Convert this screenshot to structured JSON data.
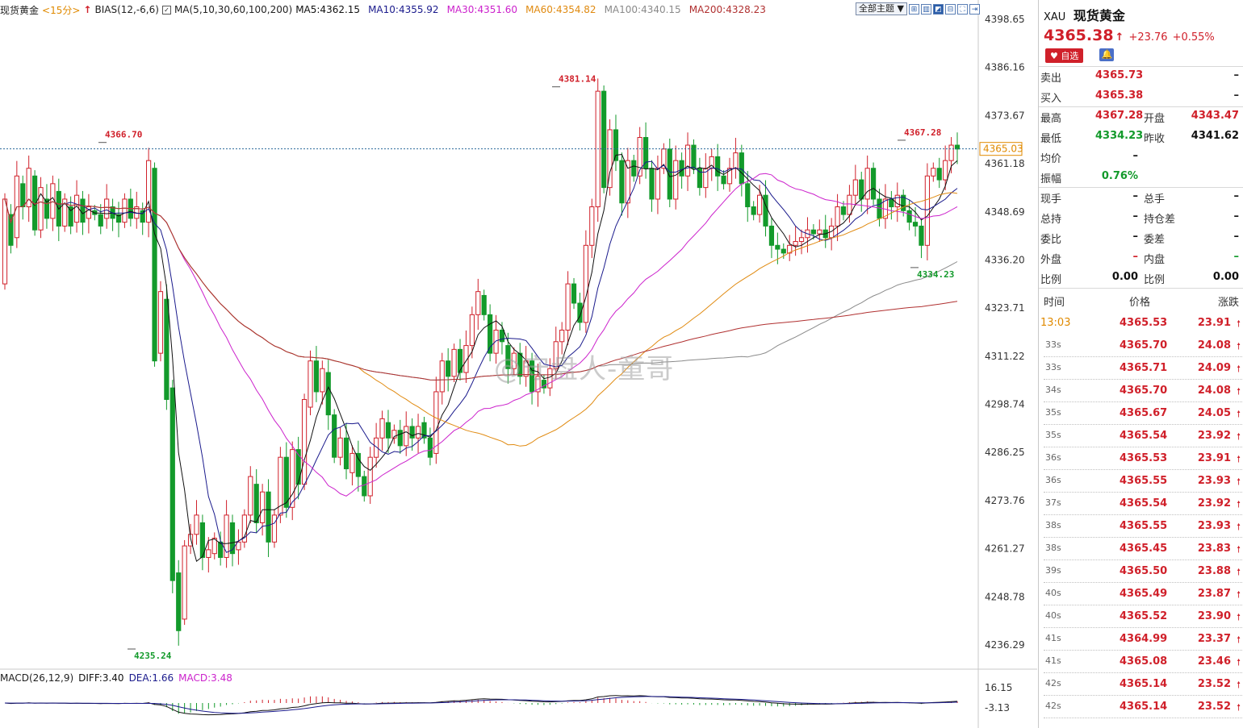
{
  "toolbar": {
    "symbol_name": "现货黄金",
    "period": "<15分>",
    "bias_label": "BIAS(12,-6,6)",
    "ma_label": "MA(5,10,30,60,100,200)",
    "ma5": "MA5:4362.15",
    "ma10": "MA10:4355.92",
    "ma30": "MA30:4351.60",
    "ma60": "MA60:4354.82",
    "ma100": "MA100:4340.15",
    "ma200": "MA200:4328.23",
    "theme_select": "全部主题"
  },
  "colors": {
    "up": "#d0202a",
    "down": "#139a2b",
    "ma5": "#111111",
    "ma10": "#1a1a8c",
    "ma30": "#cc22cc",
    "ma60": "#e08a10",
    "ma100": "#8a8a8a",
    "ma200": "#b03030"
  },
  "macd": {
    "label": "MACD(26,12,9)",
    "diff": "DIFF:3.40",
    "dea": "DEA:1.66",
    "macd": "MACD:3.48",
    "axis": [
      "16.15",
      "-3.13"
    ]
  },
  "chart_data": {
    "type": "candlestick",
    "ylim": [
      4230,
      4400
    ],
    "y_ticks": [
      "4398.65",
      "4386.16",
      "4373.67",
      "4361.18",
      "4348.69",
      "4336.20",
      "4323.71",
      "4311.22",
      "4298.74",
      "4286.25",
      "4273.76",
      "4261.27",
      "4248.78",
      "4236.29"
    ],
    "current_price_label": "4365.03",
    "annotations": {
      "high1": "4366.70",
      "high2": "4381.14",
      "high3": "4367.28",
      "low1": "4235.24",
      "low2": "4334.23"
    },
    "series": [
      {
        "name": "Price",
        "values": [
          [
            4330,
            4352
          ],
          [
            4348,
            4340
          ],
          [
            4342,
            4358
          ],
          [
            4356,
            4350
          ],
          [
            4350,
            4360
          ],
          [
            4358,
            4344
          ],
          [
            4344,
            4355
          ],
          [
            4352,
            4347
          ],
          [
            4347,
            4356
          ],
          [
            4354,
            4345
          ],
          [
            4345,
            4352
          ],
          [
            4350,
            4345
          ],
          [
            4346,
            4353
          ],
          [
            4352,
            4346
          ],
          [
            4347,
            4350
          ],
          [
            4349,
            4348
          ],
          [
            4348,
            4345
          ],
          [
            4347,
            4352
          ],
          [
            4350,
            4347
          ],
          [
            4348,
            4346
          ],
          [
            4346,
            4352
          ],
          [
            4352,
            4347
          ],
          [
            4347,
            4350
          ],
          [
            4349,
            4346
          ],
          [
            4346,
            4362
          ],
          [
            4360,
            4310
          ],
          [
            4312,
            4328
          ],
          [
            4326,
            4300
          ],
          [
            4303,
            4253
          ],
          [
            4255,
            4240
          ],
          [
            4243,
            4262
          ],
          [
            4262,
            4265
          ],
          [
            4265,
            4270
          ],
          [
            4268,
            4259
          ],
          [
            4259,
            4261
          ],
          [
            4260,
            4264
          ],
          [
            4263,
            4259
          ],
          [
            4259,
            4270
          ],
          [
            4268,
            4260
          ],
          [
            4261,
            4263
          ],
          [
            4263,
            4270
          ],
          [
            4270,
            4280
          ],
          [
            4278,
            4268
          ],
          [
            4268,
            4276
          ],
          [
            4276,
            4263
          ],
          [
            4263,
            4270
          ],
          [
            4270,
            4285
          ],
          [
            4285,
            4272
          ],
          [
            4272,
            4287
          ],
          [
            4287,
            4278
          ],
          [
            4278,
            4300
          ],
          [
            4298,
            4310
          ],
          [
            4310,
            4302
          ],
          [
            4302,
            4308
          ],
          [
            4307,
            4296
          ],
          [
            4296,
            4285
          ],
          [
            4285,
            4290
          ],
          [
            4290,
            4282
          ],
          [
            4281,
            4286
          ],
          [
            4286,
            4280
          ],
          [
            4280,
            4275
          ],
          [
            4275,
            4285
          ],
          [
            4285,
            4290
          ],
          [
            4290,
            4295
          ],
          [
            4294,
            4290
          ],
          [
            4290,
            4292
          ],
          [
            4292,
            4288
          ],
          [
            4288,
            4293
          ],
          [
            4293,
            4290
          ],
          [
            4290,
            4293
          ],
          [
            4294,
            4290
          ],
          [
            4290,
            4285
          ],
          [
            4286,
            4302
          ],
          [
            4302,
            4310
          ],
          [
            4310,
            4306
          ],
          [
            4306,
            4313
          ],
          [
            4313,
            4307
          ],
          [
            4307,
            4314
          ],
          [
            4314,
            4322
          ],
          [
            4322,
            4328
          ],
          [
            4327,
            4322
          ],
          [
            4322,
            4312
          ],
          [
            4312,
            4318
          ],
          [
            4318,
            4315
          ],
          [
            4314,
            4308
          ],
          [
            4308,
            4312
          ],
          [
            4312,
            4306
          ],
          [
            4306,
            4310
          ],
          [
            4310,
            4302
          ],
          [
            4302,
            4306
          ],
          [
            4305,
            4303
          ],
          [
            4303,
            4308
          ],
          [
            4308,
            4315
          ],
          [
            4315,
            4318
          ],
          [
            4318,
            4330
          ],
          [
            4330,
            4325
          ],
          [
            4325,
            4320
          ],
          [
            4320,
            4340
          ],
          [
            4340,
            4350
          ],
          [
            4350,
            4380
          ],
          [
            4380,
            4355
          ],
          [
            4355,
            4370
          ],
          [
            4370,
            4362
          ],
          [
            4362,
            4351
          ],
          [
            4351,
            4362
          ],
          [
            4362,
            4358
          ],
          [
            4358,
            4368
          ],
          [
            4368,
            4360
          ],
          [
            4360,
            4352
          ],
          [
            4352,
            4360
          ],
          [
            4360,
            4365
          ],
          [
            4365,
            4352
          ],
          [
            4352,
            4362
          ],
          [
            4362,
            4358
          ],
          [
            4358,
            4366
          ],
          [
            4366,
            4360
          ],
          [
            4360,
            4355
          ],
          [
            4355,
            4360
          ],
          [
            4360,
            4363
          ],
          [
            4363,
            4358
          ],
          [
            4358,
            4356
          ],
          [
            4356,
            4360
          ],
          [
            4360,
            4364
          ],
          [
            4364,
            4356
          ],
          [
            4356,
            4350
          ],
          [
            4350,
            4348
          ],
          [
            4348,
            4353
          ],
          [
            4353,
            4345
          ],
          [
            4345,
            4340
          ],
          [
            4340,
            4339
          ],
          [
            4339,
            4338
          ],
          [
            4338,
            4340
          ],
          [
            4340,
            4341
          ],
          [
            4341,
            4342
          ],
          [
            4342,
            4344
          ],
          [
            4344,
            4343
          ],
          [
            4343,
            4344
          ],
          [
            4344,
            4342
          ],
          [
            4342,
            4345
          ],
          [
            4345,
            4350
          ],
          [
            4350,
            4348
          ],
          [
            4348,
            4353
          ],
          [
            4353,
            4357
          ],
          [
            4357,
            4352
          ],
          [
            4352,
            4360
          ],
          [
            4360,
            4352
          ],
          [
            4352,
            4347
          ],
          [
            4347,
            4352
          ],
          [
            4352,
            4350
          ],
          [
            4350,
            4353
          ],
          [
            4353,
            4349
          ],
          [
            4349,
            4346
          ],
          [
            4346,
            4345
          ],
          [
            4345,
            4340
          ],
          [
            4340,
            4358
          ],
          [
            4358,
            4360
          ],
          [
            4360,
            4357
          ],
          [
            4357,
            4362
          ],
          [
            4362,
            4366
          ],
          [
            4366,
            4365
          ]
        ]
      }
    ]
  },
  "sidebar": {
    "code": "XAU",
    "name": "现货黄金",
    "price": "4365.38",
    "arrow": "↑",
    "change": "+23.76",
    "change_pct": "+0.55%",
    "fav_label": "♥ 自选",
    "bell_label": "🔔",
    "quote_rows": [
      {
        "k1": "卖出",
        "v1": "4365.73",
        "k2": "",
        "v2": "–"
      },
      {
        "k1": "买入",
        "v1": "4365.38",
        "k2": "",
        "v2": "–"
      },
      {
        "k1": "最高",
        "v1": "4367.28",
        "k2": "开盘",
        "v2": "4343.47"
      },
      {
        "k1": "最低",
        "v1": "4334.23",
        "k2": "昨收",
        "v2": "4341.62"
      },
      {
        "k1": "均价",
        "v1": "–",
        "k2": "",
        "v2": ""
      },
      {
        "k1": "振幅",
        "v1": "0.76%",
        "k2": "",
        "v2": ""
      },
      {
        "k1": "现手",
        "v1": "–",
        "k2": "总手",
        "v2": "–"
      },
      {
        "k1": "总持",
        "v1": "–",
        "k2": "持仓差",
        "v2": "–"
      },
      {
        "k1": "委比",
        "v1": "–",
        "k2": "委差",
        "v2": "–"
      },
      {
        "k1": "外盘",
        "v1": "–",
        "k2": "内盘",
        "v2": "–"
      },
      {
        "k1": "比例",
        "v1": "0.00",
        "k2": "比例",
        "v2": "0.00"
      }
    ],
    "tick_header": {
      "time": "时间",
      "price": "价格",
      "change": "涨跌"
    },
    "ticks": [
      {
        "t": "13:03",
        "p": "4365.53",
        "c": "23.91"
      },
      {
        "t": "33s",
        "p": "4365.70",
        "c": "24.08"
      },
      {
        "t": "33s",
        "p": "4365.71",
        "c": "24.09"
      },
      {
        "t": "34s",
        "p": "4365.70",
        "c": "24.08"
      },
      {
        "t": "35s",
        "p": "4365.67",
        "c": "24.05"
      },
      {
        "t": "35s",
        "p": "4365.54",
        "c": "23.92"
      },
      {
        "t": "36s",
        "p": "4365.53",
        "c": "23.91"
      },
      {
        "t": "36s",
        "p": "4365.55",
        "c": "23.93"
      },
      {
        "t": "37s",
        "p": "4365.54",
        "c": "23.92"
      },
      {
        "t": "38s",
        "p": "4365.55",
        "c": "23.93"
      },
      {
        "t": "38s",
        "p": "4365.45",
        "c": "23.83"
      },
      {
        "t": "39s",
        "p": "4365.50",
        "c": "23.88"
      },
      {
        "t": "40s",
        "p": "4365.49",
        "c": "23.87"
      },
      {
        "t": "40s",
        "p": "4365.52",
        "c": "23.90"
      },
      {
        "t": "41s",
        "p": "4364.99",
        "c": "23.37"
      },
      {
        "t": "41s",
        "p": "4365.08",
        "c": "23.46"
      },
      {
        "t": "42s",
        "p": "4365.14",
        "c": "23.52"
      },
      {
        "t": "42s",
        "p": "4365.14",
        "c": "23.52"
      }
    ]
  },
  "watermark": "@守盘人-童哥"
}
